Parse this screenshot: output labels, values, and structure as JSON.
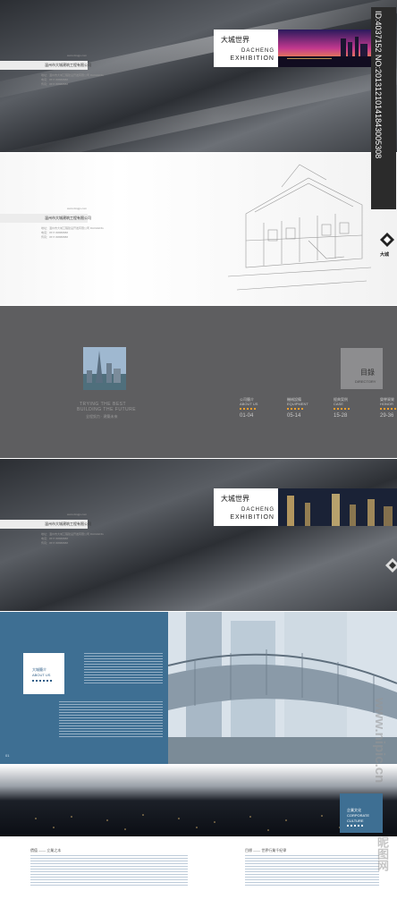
{
  "cover": {
    "title_cn": "大城世界",
    "title_en1": "DACHENG",
    "title_en2": "EXHIBITION",
    "url_small": "www.dcsjgs.com",
    "company_name": "温州市大城建筑工程有限公司",
    "address_lines": [
      "地址：温州市大城工程建设开发有限公司 DACHENG",
      "电话：0577-88888888",
      "传真：0577-88888888"
    ]
  },
  "inner_cover": {
    "url_small": "www.dcsjgs.com",
    "company_name": "温州市大城建筑工程有限公司",
    "address_lines": [
      "地址：温州市大城工程建设开发有限公司 DACHENG",
      "电话：0577-88888888",
      "传真：0577-88888888"
    ]
  },
  "directory": {
    "title_cn": "目錄",
    "title_en": "DIRECTORY",
    "slogan_en1": "TRYING THE BEST",
    "slogan_en2": "BUILDING THE FUTURE",
    "slogan_cn": "全程努力 · 建築未來",
    "items": [
      {
        "cn": "公司簡介",
        "en": "ABOUT US",
        "range": "01-04"
      },
      {
        "cn": "機械設備",
        "en": "EQUIPMENT",
        "range": "05-14"
      },
      {
        "cn": "經典案例",
        "en": "CASE",
        "range": "15-28"
      },
      {
        "cn": "榮譽資質",
        "en": "HONOR",
        "range": "29-36"
      }
    ]
  },
  "back_cover": {
    "title_cn": "大城世界",
    "title_en1": "DACHENG",
    "title_en2": "EXHIBITION",
    "url_small": "www.dcsjgs.com",
    "company_name": "温州市大城建筑工程有限公司",
    "address_lines": [
      "地址：温州市大城工程建设开发有限公司 DACHENG",
      "电话：0577-88888888",
      "传真：0577-88888888"
    ]
  },
  "about": {
    "title_cn": "大城簡介",
    "title_en": "ABOUT US",
    "page_no": "01"
  },
  "culture": {
    "title_cn": "企業文化",
    "title_en1": "CORPORATE",
    "title_en2": "CULTURE",
    "left_heading": "價值 —— 立業之本",
    "right_heading": "目標 —— 世界行業千紀律"
  },
  "watermark": {
    "id_text": "ID:4037152 NO:20131210141843005308",
    "url": "www.nipic.cn",
    "site": "昵图网"
  },
  "logo_text": "大城"
}
